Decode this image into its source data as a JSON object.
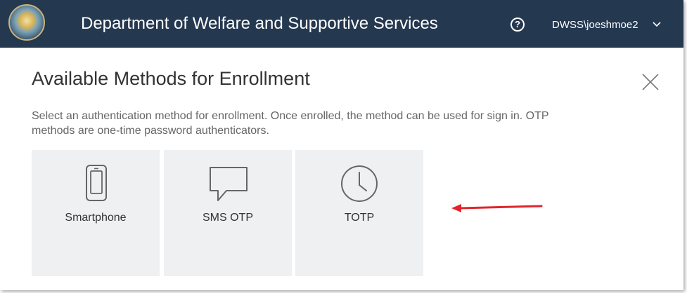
{
  "header": {
    "title": "Department of Welfare and Supportive Services",
    "help_icon_glyph": "?",
    "user": "DWSS\\joeshmoe2",
    "bg_color": "#243850"
  },
  "panel": {
    "title": "Available Methods for Enrollment",
    "description": "Select an authentication method for enrollment. Once enrolled, the method can be used for sign in. OTP methods are one-time password authenticators."
  },
  "methods": [
    {
      "label": "Smartphone",
      "icon": "smartphone-icon"
    },
    {
      "label": "SMS OTP",
      "icon": "chat-bubble-icon"
    },
    {
      "label": "TOTP",
      "icon": "clock-icon"
    }
  ],
  "annotation": {
    "arrow_color": "#e0252b"
  }
}
